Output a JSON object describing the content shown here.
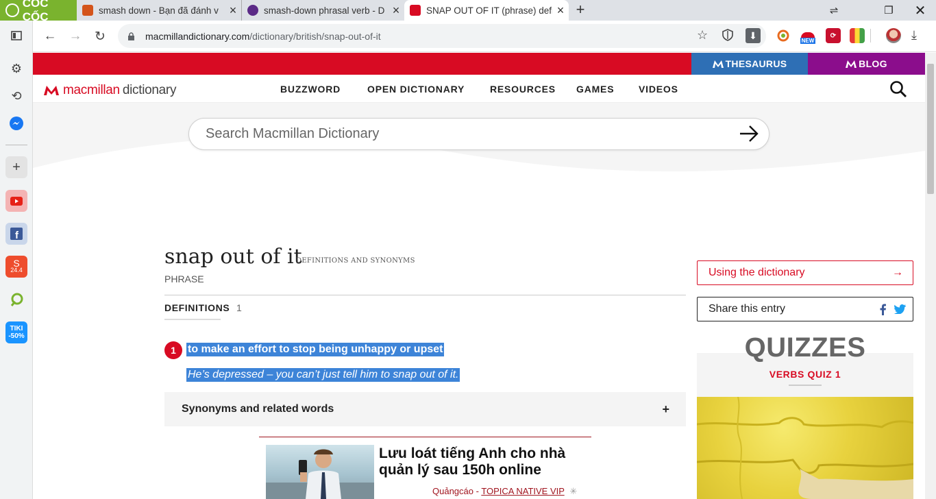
{
  "browser": {
    "brand": "CỐC CỐC",
    "tabs": [
      {
        "title": "smash down - Bạn đã đánh v",
        "favicon_color": "#d4541b",
        "active": false
      },
      {
        "title": "smash-down phrasal verb - D",
        "favicon_color": "#5b2a86",
        "active": false
      },
      {
        "title": "SNAP OUT OF IT (phrase) defi",
        "favicon_color": "#d80b23",
        "active": true
      }
    ],
    "new_tab": "+",
    "url_domain": "macmillandictionary.com",
    "url_path": "/dictionary/british/snap-out-of-it",
    "extensions": [
      "coccoc-icon",
      "new-badge-icon",
      "red-ext-icon",
      "colors-ext-icon",
      "avatar",
      "download-icon"
    ],
    "new_badge": "NEW",
    "sidebar": [
      "settings-icon",
      "history-icon",
      "messenger-icon",
      "add-icon",
      "youtube-icon",
      "facebook-icon",
      "shopee-icon",
      "coccoc-leaf-icon",
      "tiki-icon"
    ],
    "tiki_label": "TIKI -50%",
    "shopee_date": "24.4"
  },
  "site": {
    "thesaurus": "THESAURUS",
    "blog": "BLOG",
    "logo_main": "macmillan",
    "logo_second": "dictionary",
    "nav": [
      "BUZZWORD",
      "OPEN DICTIONARY",
      "RESOURCES",
      "GAMES",
      "VIDEOS"
    ],
    "search_placeholder": "Search Macmillan Dictionary"
  },
  "entry": {
    "headword": "snap out of it",
    "subhead": "DEFINITIONS AND SYNONYMS",
    "pos": "PHRASE",
    "definitions_label": "DEFINITIONS",
    "definitions_count": "1",
    "sense_number": "1",
    "definition": "to make an effort to stop being unhappy or upset",
    "example": "He’s depressed – you can’t just tell him to snap out of it.",
    "synonyms_label": "Synonyms and related words",
    "synonyms_toggle": "+"
  },
  "ad": {
    "title": "Lưu loát tiếng Anh cho nhà quản lý sau 150h online",
    "source_prefix": "Quảngcáo - ",
    "source_link": "TOPICA NATIVE VIP"
  },
  "sidebar_right": {
    "using": "Using the dictionary",
    "share": "Share this entry",
    "quizzes": "QUIZZES",
    "quiz_title": "VERBS QUIZ 1"
  },
  "colors": {
    "brand_red": "#d80b23",
    "thesaurus_blue": "#2e6fb5",
    "blog_purple": "#8b0d8c",
    "selection": "#3d84d8",
    "coccoc_green": "#7ab32e"
  }
}
